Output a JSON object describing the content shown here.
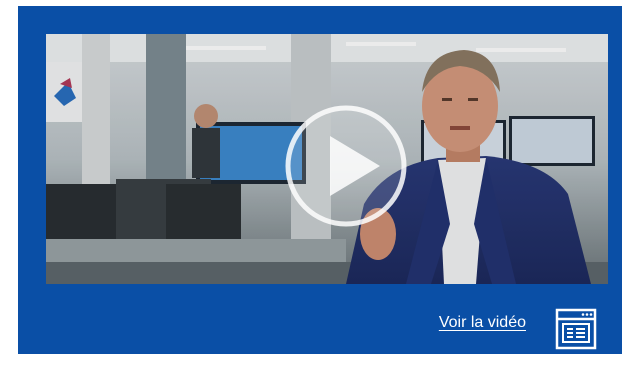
{
  "video": {
    "thumbnail_subject": "man-speaking-in-office",
    "play_icon": "play-icon"
  },
  "footer": {
    "link_label": "Voir la vidéo",
    "link_icon": "video-player-icon"
  },
  "colors": {
    "panel": "#0a4fa6",
    "text": "#ffffff"
  }
}
